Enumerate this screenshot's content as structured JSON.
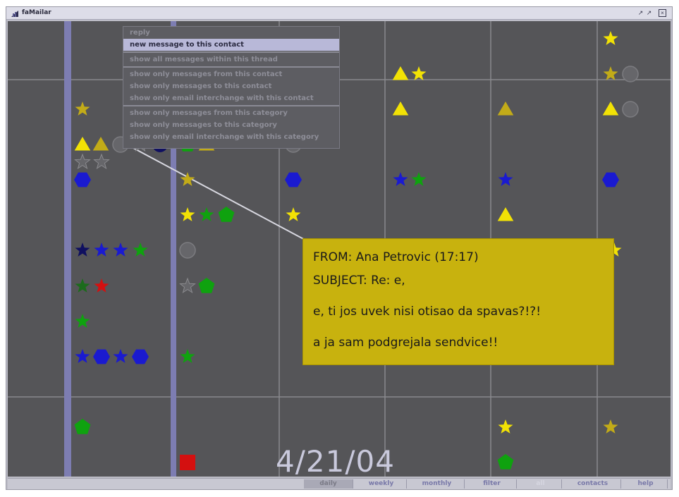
{
  "app": {
    "title": "faMailar",
    "date": "4/21/04"
  },
  "window_buttons": [
    "minimize-icon",
    "maximize-icon",
    "close-icon"
  ],
  "context_menu": {
    "groups": [
      [
        "reply",
        "new message to this contact"
      ],
      [
        "show all messages within this thread"
      ],
      [
        "show only messages from this contact",
        "show only messages to this contact",
        "show only email interchange with this contact"
      ],
      [
        "show only messages from this category",
        "show only messages to this category",
        "show only email interchange with this category"
      ]
    ],
    "highlighted": "new message to this contact"
  },
  "tooltip": {
    "from": "FROM: Ana Petrovic (17:17)",
    "subject": "SUBJECT: Re: e,",
    "body_line1": "e, ti jos uvek nisi otisao da spavas?!?!",
    "body_line2": "a ja sam podgrejala sendvice!!"
  },
  "bottom_tabs": [
    {
      "label": "daily",
      "state": "active"
    },
    {
      "label": "weekly",
      "state": "normal"
    },
    {
      "label": "monthly",
      "state": "normal"
    },
    {
      "label": "filter",
      "state": "normal"
    },
    {
      "label": "all",
      "state": "disabled"
    },
    {
      "label": "contacts",
      "state": "normal"
    },
    {
      "label": "help",
      "state": "normal"
    }
  ],
  "colors": {
    "canvas": "#555558",
    "gridline": "#8a8a8e",
    "column_highlight": "#7d7db2",
    "yellow": "#f2e205",
    "olive": "#c2ab18",
    "green": "#0fa20f",
    "dark_green": "#1c6b1c",
    "blue": "#1a1ad0",
    "navy": "#101060",
    "red": "#d41010",
    "gray": "#66666a",
    "tooltip_bg": "#c8b20e"
  },
  "message_glyphs": [
    {
      "shape": "star",
      "color": "yellow"
    },
    {
      "shape": "triangle",
      "color": "yellow"
    },
    {
      "shape": "triangle",
      "color": "olive"
    },
    {
      "shape": "circle",
      "color": "gray"
    },
    {
      "shape": "star",
      "color": "gray"
    },
    {
      "shape": "circle",
      "color": "navy"
    },
    {
      "shape": "triangle",
      "color": "yellow"
    },
    {
      "shape": "star",
      "color": "yellow"
    },
    {
      "shape": "star",
      "color": "olive"
    },
    {
      "shape": "circle",
      "color": "gray"
    },
    {
      "shape": "star",
      "color": "olive"
    },
    {
      "shape": "triangle",
      "color": "yellow"
    },
    {
      "shape": "triangle",
      "color": "olive"
    },
    {
      "shape": "triangle",
      "color": "yellow"
    },
    {
      "shape": "circle",
      "color": "gray"
    },
    {
      "shape": "pentagon",
      "color": "green"
    },
    {
      "shape": "triangle",
      "color": "olive"
    },
    {
      "shape": "circle",
      "color": "gray"
    },
    {
      "shape": "star",
      "color": "gray"
    },
    {
      "shape": "star",
      "color": "gray"
    },
    {
      "shape": "hexagon",
      "color": "blue"
    },
    {
      "shape": "star",
      "color": "olive"
    },
    {
      "shape": "hexagon",
      "color": "blue"
    },
    {
      "shape": "star",
      "color": "blue"
    },
    {
      "shape": "star",
      "color": "green"
    },
    {
      "shape": "star",
      "color": "blue"
    },
    {
      "shape": "hexagon",
      "color": "blue"
    },
    {
      "shape": "star",
      "color": "yellow"
    },
    {
      "shape": "star",
      "color": "green"
    },
    {
      "shape": "pentagon",
      "color": "green"
    },
    {
      "shape": "star",
      "color": "yellow"
    },
    {
      "shape": "triangle",
      "color": "yellow"
    },
    {
      "shape": "star",
      "color": "navy"
    },
    {
      "shape": "star",
      "color": "blue"
    },
    {
      "shape": "star",
      "color": "blue"
    },
    {
      "shape": "star",
      "color": "green"
    },
    {
      "shape": "circle",
      "color": "gray"
    },
    {
      "shape": "star",
      "color": "yellow"
    },
    {
      "shape": "star",
      "color": "dark_green"
    },
    {
      "shape": "star",
      "color": "red"
    },
    {
      "shape": "star",
      "color": "gray"
    },
    {
      "shape": "pentagon",
      "color": "green"
    },
    {
      "shape": "star",
      "color": "green"
    },
    {
      "shape": "star",
      "color": "blue"
    },
    {
      "shape": "hexagon",
      "color": "blue"
    },
    {
      "shape": "star",
      "color": "blue"
    },
    {
      "shape": "hexagon",
      "color": "blue"
    },
    {
      "shape": "star",
      "color": "green"
    },
    {
      "shape": "pentagon",
      "color": "green"
    },
    {
      "shape": "star",
      "color": "yellow"
    },
    {
      "shape": "star",
      "color": "olive"
    },
    {
      "shape": "square",
      "color": "red"
    },
    {
      "shape": "pentagon",
      "color": "green"
    }
  ]
}
